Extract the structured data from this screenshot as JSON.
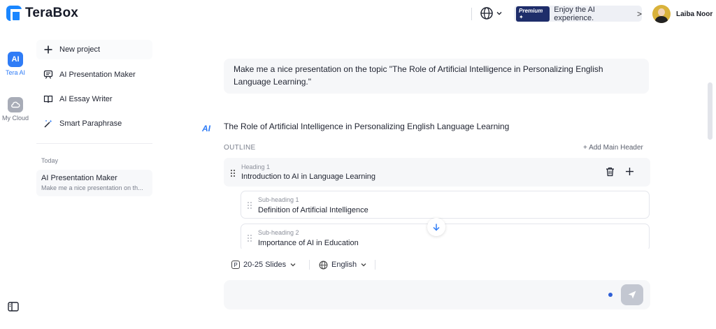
{
  "header": {
    "brand": "TeraBox",
    "promo": {
      "badge": "Premium ✦",
      "text": "Enjoy the AI experience.",
      "chevron": ">"
    },
    "user": {
      "name": "Laiba Noor"
    }
  },
  "rail": {
    "items": [
      {
        "icon_text": "AI",
        "label": "Tera AI",
        "active": true
      },
      {
        "label": "My Cloud",
        "active": false
      }
    ]
  },
  "sidebar": {
    "items": [
      {
        "icon": "plus-icon",
        "label": "New project"
      },
      {
        "icon": "presentation-icon",
        "label": "AI Presentation Maker"
      },
      {
        "icon": "book-icon",
        "label": "AI Essay Writer"
      },
      {
        "icon": "magic-wand-icon",
        "label": "Smart Paraphrase"
      }
    ],
    "history_group": "Today",
    "history": [
      {
        "title": "AI Presentation Maker",
        "subtitle": "Make me a nice presentation on th..."
      }
    ]
  },
  "chat": {
    "prompt": "Make me a nice presentation on the topic \"The Role of Artificial Intelligence in Personalizing English Language Learning.\"",
    "ai_mark": "AI",
    "response_title": "The Role of Artificial Intelligence in Personalizing English Language Learning",
    "outline_label": "OUTLINE",
    "add_main_header": "+ Add Main Header",
    "outline": {
      "heading": {
        "label": "Heading 1",
        "value": "Introduction to AI in Language Learning"
      },
      "subheadings": [
        {
          "label": "Sub-heading 1",
          "value": "Definition of Artificial Intelligence"
        },
        {
          "label": "Sub-heading 2",
          "value": "Importance of AI in Education"
        }
      ]
    },
    "options": {
      "slides": {
        "badge": "P",
        "value": "20-25 Slides"
      },
      "language": {
        "value": "English"
      }
    },
    "composer": {
      "placeholder": ""
    }
  },
  "colors": {
    "accent": "#2f7cf6",
    "brand": "#1a86ff",
    "premium": "#1e2d6a"
  }
}
